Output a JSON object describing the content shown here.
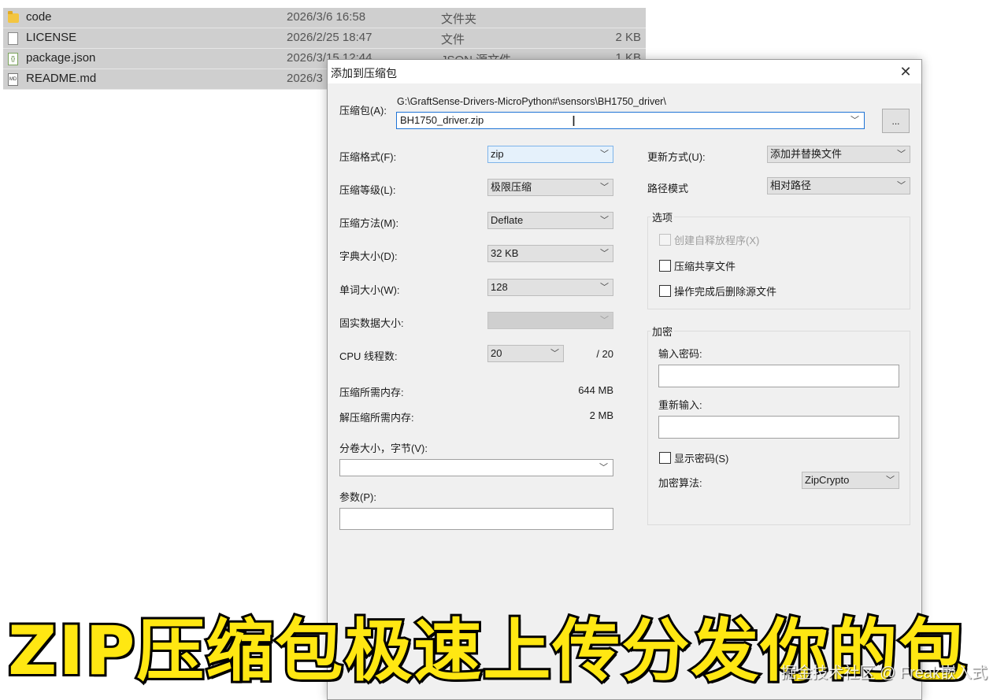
{
  "files": [
    {
      "name": "code",
      "date": "2026/3/6 16:58",
      "type": "文件夹",
      "size": "",
      "icon": "folder-icon"
    },
    {
      "name": "LICENSE",
      "date": "2026/2/25 18:47",
      "type": "文件",
      "size": "2 KB",
      "icon": "file-icon"
    },
    {
      "name": "package.json",
      "date": "2026/3/15 12:44",
      "type": "JSON 源文件",
      "size": "1 KB",
      "icon": "json-file-icon"
    },
    {
      "name": "README.md",
      "date": "2026/3",
      "type": "",
      "size": "",
      "icon": "md-file-icon"
    }
  ],
  "dialog": {
    "title": "添加到压缩包",
    "close_glyph": "✕",
    "archive_label": "压缩包(A):",
    "archive_path": "G:\\GraftSense-Drivers-MicroPython#\\sensors\\BH1750_driver\\",
    "archive_name": "BH1750_driver.zip",
    "browse_label": "...",
    "left": {
      "format_label": "压缩格式(F):",
      "format_value": "zip",
      "level_label": "压缩等级(L):",
      "level_value": "极限压缩",
      "method_label": "压缩方法(M):",
      "method_value": "Deflate",
      "dict_label": "字典大小(D):",
      "dict_value": "32 KB",
      "word_label": "单词大小(W):",
      "word_value": "128",
      "solid_label": "固实数据大小:",
      "solid_value": "",
      "cpu_label": "CPU 线程数:",
      "cpu_value": "20",
      "cpu_total": "/ 20",
      "mem_comp_label": "压缩所需内存:",
      "mem_comp_value": "644 MB",
      "mem_decomp_label": "解压缩所需内存:",
      "mem_decomp_value": "2 MB",
      "split_label": "分卷大小，字节(V):",
      "split_value": "",
      "params_label": "参数(P):",
      "params_value": ""
    },
    "right": {
      "update_label": "更新方式(U):",
      "update_value": "添加并替换文件",
      "path_label": "路径模式",
      "path_value": "相对路径",
      "options_title": "选项",
      "opt_sfx": "创建自释放程序(X)",
      "opt_shared": "压缩共享文件",
      "opt_delete": "操作完成后删除源文件",
      "encrypt_title": "加密",
      "password_label": "输入密码:",
      "reenter_label": "重新输入:",
      "show_password": "显示密码(S)",
      "enc_method_label": "加密算法:",
      "enc_method_value": "ZipCrypto"
    }
  },
  "caption": "ZIP压缩包极速上传分发你的包",
  "watermark": "掘金技术社区 @ Freak嵌入式",
  "colors": {
    "caption_fill": "#ffe712",
    "caption_stroke": "#000000",
    "dialog_bg": "#f0f0f0",
    "active_border": "#1f74d6"
  }
}
